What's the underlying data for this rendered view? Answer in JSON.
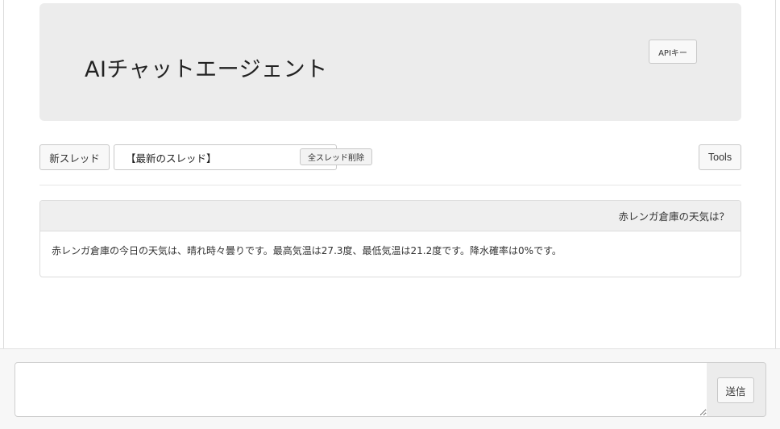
{
  "header": {
    "title": "AIチャットエージェント",
    "api_key_label": "APIキー"
  },
  "toolbar": {
    "new_thread_label": "新スレッド",
    "thread_select": {
      "selected": "【最新のスレッド】"
    },
    "delete_all_label": "全スレッド削除",
    "tools_label": "Tools"
  },
  "messages": [
    {
      "question": "赤レンガ倉庫の天気は？",
      "answer": "赤レンガ倉庫の今日の天気は、晴れ時々曇りです。最高気温は27.3度、最低気温は21.2度です。降水確率は0%です。"
    }
  ],
  "composer": {
    "value": "",
    "send_label": "送信"
  }
}
